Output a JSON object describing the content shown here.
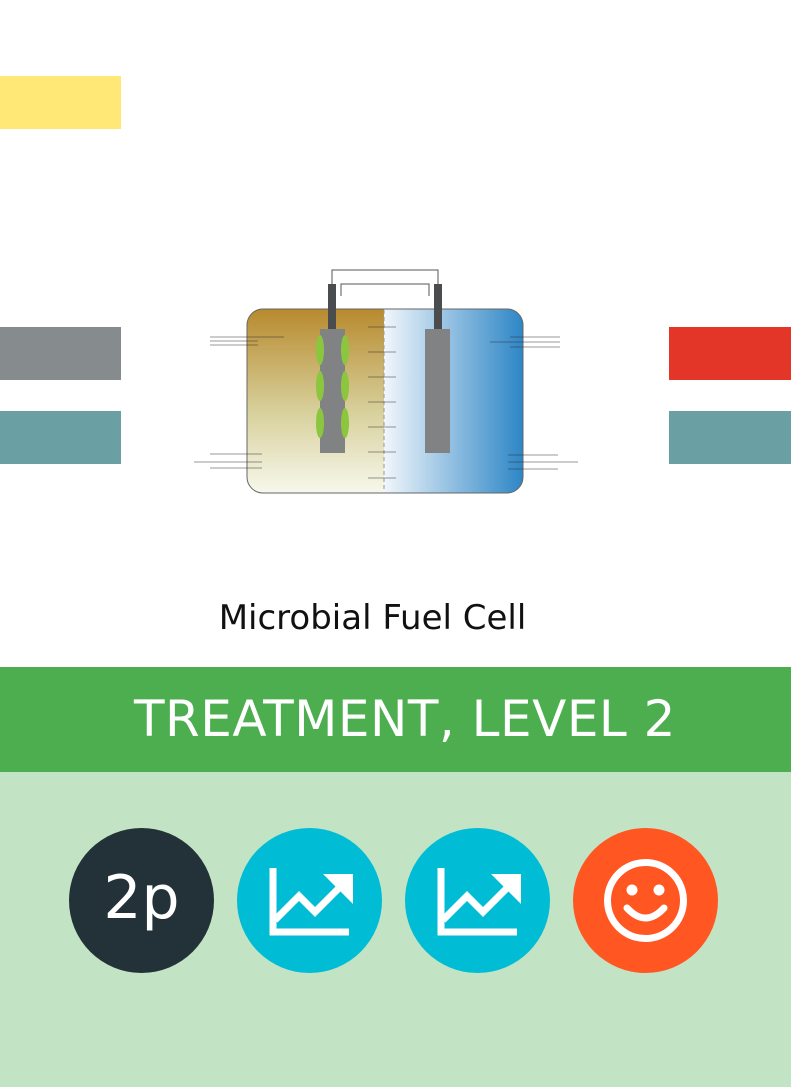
{
  "side_bars": {
    "left_top_color": "#ffe876",
    "left_mid_color": "#868b8e",
    "left_bottom_color": "#6aa0a3",
    "right_mid_color": "#e43628",
    "right_bottom_color": "#6aa0a3"
  },
  "diagram": {
    "anode_gradient": [
      "#b88a2e",
      "#eef0d8"
    ],
    "cathode_gradient": [
      "#e6f1fa",
      "#2d86c6"
    ],
    "electrode_color": "#808284",
    "microbe_color": "#8cc63f"
  },
  "caption": "Microbial Fuel Cell",
  "banner": {
    "title": "TREATMENT, LEVEL 2",
    "color": "#4cae4f"
  },
  "footer": {
    "color": "#c3e3c5"
  },
  "badges": [
    {
      "text": "2p",
      "icon": "",
      "color": "#233238"
    },
    {
      "text": "",
      "icon": "trending-up-icon",
      "color": "#00bcd5"
    },
    {
      "text": "",
      "icon": "trending-up-icon",
      "color": "#00bcd5"
    },
    {
      "text": "",
      "icon": "smiley-face-icon",
      "color": "#ff5622"
    }
  ]
}
